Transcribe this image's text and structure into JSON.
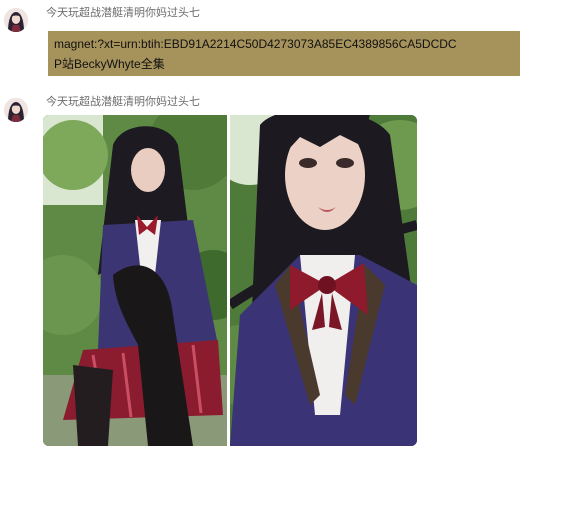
{
  "messages": [
    {
      "sender": "今天玩超战潜艇清明你妈过头七",
      "text_lines": [
        "magnet:?xt=urn:btih:EBD91A2214C50D4273073A85EC4389856CA5DCDC",
        "P站BeckyWhyte全集"
      ]
    },
    {
      "sender": "今天玩超战潜艇清明你妈过头七",
      "images": [
        "cosplay-photo-full-body",
        "cosplay-photo-closeup"
      ]
    }
  ],
  "colors": {
    "bubble_background": "#a6925b",
    "sender_text": "#6b6b6b",
    "page_background": "#ffffff"
  }
}
